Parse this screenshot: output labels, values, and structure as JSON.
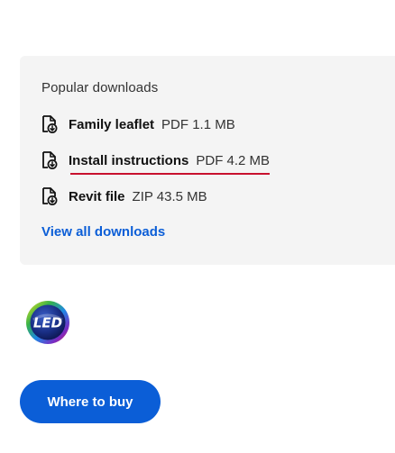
{
  "downloads": {
    "title": "Popular downloads",
    "items": [
      {
        "name": "Family leaflet",
        "meta": "PDF 1.1 MB",
        "icon": "file-download-icon"
      },
      {
        "name": "Install instructions",
        "meta": "PDF 4.2 MB",
        "icon": "file-download-icon",
        "active": true
      },
      {
        "name": "Revit file",
        "meta": "ZIP 43.5 MB",
        "icon": "file-download-icon"
      }
    ],
    "view_all_label": "View all downloads"
  },
  "badge": {
    "text": "LED",
    "icon": "led-logo-icon"
  },
  "cta": {
    "label": "Where to buy"
  },
  "colors": {
    "accent": "#0b5ed7",
    "active_underline": "#c8102e",
    "panel_bg": "#f4f4f4"
  }
}
